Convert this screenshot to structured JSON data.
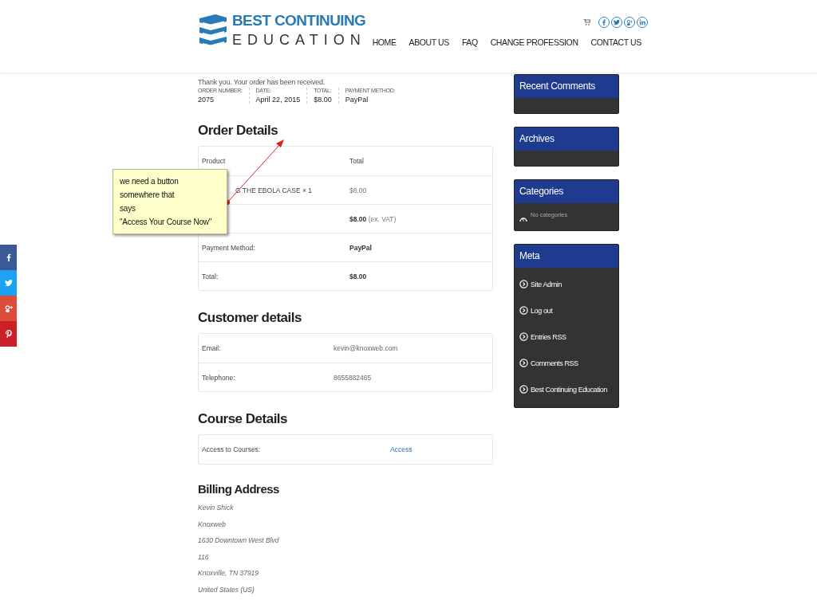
{
  "header": {
    "logo": {
      "line1": "BEST CONTINUING",
      "line2": "EDUCATION"
    },
    "social": [
      {
        "kind": "facebook"
      },
      {
        "kind": "twitter"
      },
      {
        "kind": "googleplus"
      },
      {
        "kind": "linkedin"
      }
    ],
    "nav": [
      {
        "label": "HOME"
      },
      {
        "label": "ABOUT US"
      },
      {
        "label": "FAQ"
      },
      {
        "label": "CHANGE PROFESSION"
      },
      {
        "label": "CONTACT US"
      }
    ]
  },
  "share_bar": [
    {
      "kind": "facebook",
      "color": "#3b5998"
    },
    {
      "kind": "twitter",
      "color": "#1da1f2"
    },
    {
      "kind": "googleplus",
      "color": "#dd4b39"
    },
    {
      "kind": "pinterest",
      "color": "#cb2027"
    }
  ],
  "order_received": {
    "message": "Thank you. Your order has been received.",
    "fields": [
      {
        "label": "ORDER NUMBER:",
        "value": "2075"
      },
      {
        "label": "DATE:",
        "value": "April 22, 2015"
      },
      {
        "label": "TOTAL:",
        "value": "$8.00"
      },
      {
        "label": "PAYMENT METHOD:",
        "value": "PayPal"
      }
    ]
  },
  "order_details": {
    "title": "Order Details",
    "columns": [
      "Product",
      "Total"
    ],
    "rows": [
      {
        "kind": "item",
        "label": "G THE EBOLA CASE × 1",
        "value": "$8.00"
      },
      {
        "kind": "strong",
        "value": "$8.00",
        "note": "(ex. VAT)"
      },
      {
        "kind": "strong",
        "label": "Payment Method:",
        "value": "PayPal"
      },
      {
        "kind": "strong",
        "label": "Total:",
        "value": "$8.00"
      }
    ]
  },
  "customer_details": {
    "title": "Customer details",
    "rows": [
      {
        "kind": "text",
        "label": "Email:",
        "value": "kevin@knoxweb.com"
      },
      {
        "kind": "text",
        "label": "Telephone:",
        "value": "8655882465"
      }
    ]
  },
  "course_details": {
    "title": "Course Details",
    "rows": [
      {
        "kind": "link",
        "label": "Access to Courses:",
        "value": "Access"
      }
    ]
  },
  "billing_address": {
    "title": "Billing Address",
    "lines": [
      "Kevin Shick",
      "Knoxweb",
      "1630 Downtown West Blvd",
      "116",
      "Knoxville, TN 37919",
      "United States (US)"
    ]
  },
  "sidebar": {
    "widgets": [
      {
        "title": "Recent Comments"
      },
      {
        "title": "Archives"
      },
      {
        "title": "Categories",
        "empty_text": "No categories"
      },
      {
        "title": "Meta",
        "links": [
          "Site Admin",
          "Log out",
          "Entries RSS",
          "Comments RSS",
          "Best Continuing Education"
        ]
      }
    ]
  },
  "annotation": {
    "lines": [
      "we need a button",
      "somewhere that",
      "says",
      "\"Access Your Course Now\""
    ]
  }
}
